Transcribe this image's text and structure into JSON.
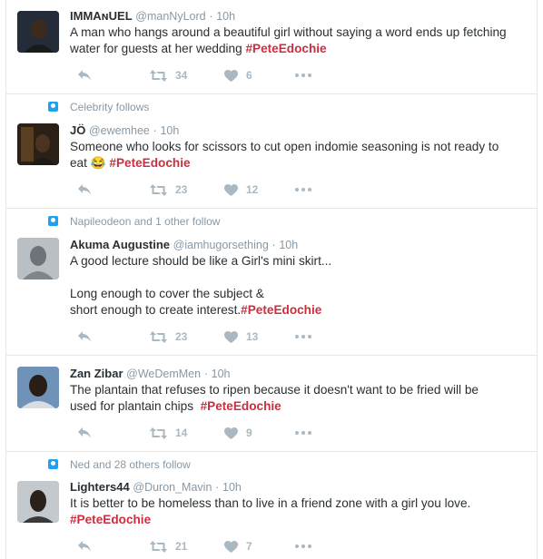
{
  "tweets": [
    {
      "context": "",
      "name": "IMMAɴUEL",
      "handle": "@manNyLord",
      "time": "10h",
      "text_lines": [
        "A man who hangs around a beautiful girl without saying a word ends up fetching",
        "water for guests at her wedding "
      ],
      "hashtag": "#PeteEdochie",
      "retweets": "34",
      "likes": "6",
      "avatar_color": "#1c2430"
    },
    {
      "context": "Celebrity follows",
      "name": "JÖ",
      "handle": "@ewemhee",
      "time": "10h",
      "text_lines": [
        "Someone who looks for scissors to cut open indomie seasoning is not ready to",
        "eat 😂 "
      ],
      "hashtag": "#PeteEdochie",
      "retweets": "23",
      "likes": "12",
      "avatar_color": "#3a2a1c"
    },
    {
      "context": "Napileodeon and 1 other follow",
      "name": "Akuma Augustine",
      "handle": "@iamhugorsething",
      "time": "10h",
      "text_lines": [
        "A good lecture should be like a Girl's mini skirt...",
        "",
        "Long enough to cover the subject &",
        "short enough to create interest."
      ],
      "hashtag": "#PeteEdochie",
      "retweets": "23",
      "likes": "13",
      "avatar_color": "#9aa3a8"
    },
    {
      "context": "",
      "name": "Zan Zibar",
      "handle": "@WeDemMen",
      "time": "10h",
      "text_lines": [
        "The plantain that refuses to ripen because it doesn't want to be fried will be",
        "used for plantain chips  "
      ],
      "hashtag": "#PeteEdochie",
      "retweets": "14",
      "likes": "9",
      "avatar_color": "#5b7fa6"
    },
    {
      "context": "Ned and 28 others follow",
      "name": "Lighters44",
      "handle": "@Duron_Mavin",
      "time": "10h",
      "text_lines": [
        "It is better to be homeless than to live in a friend zone with a girl you love.",
        ""
      ],
      "hashtag": "#PeteEdochie",
      "retweets": "21",
      "likes": "7",
      "avatar_color": "#a8aeb3"
    }
  ],
  "icons": {
    "reply": "reply-icon",
    "retweet": "retweet-icon",
    "like": "heart-icon",
    "more": "more-icon",
    "context": "follow-context-icon"
  },
  "colors": {
    "hashtag": "#cc2e3f",
    "action": "#aab8c2",
    "context_icon": "#1da1f2"
  }
}
